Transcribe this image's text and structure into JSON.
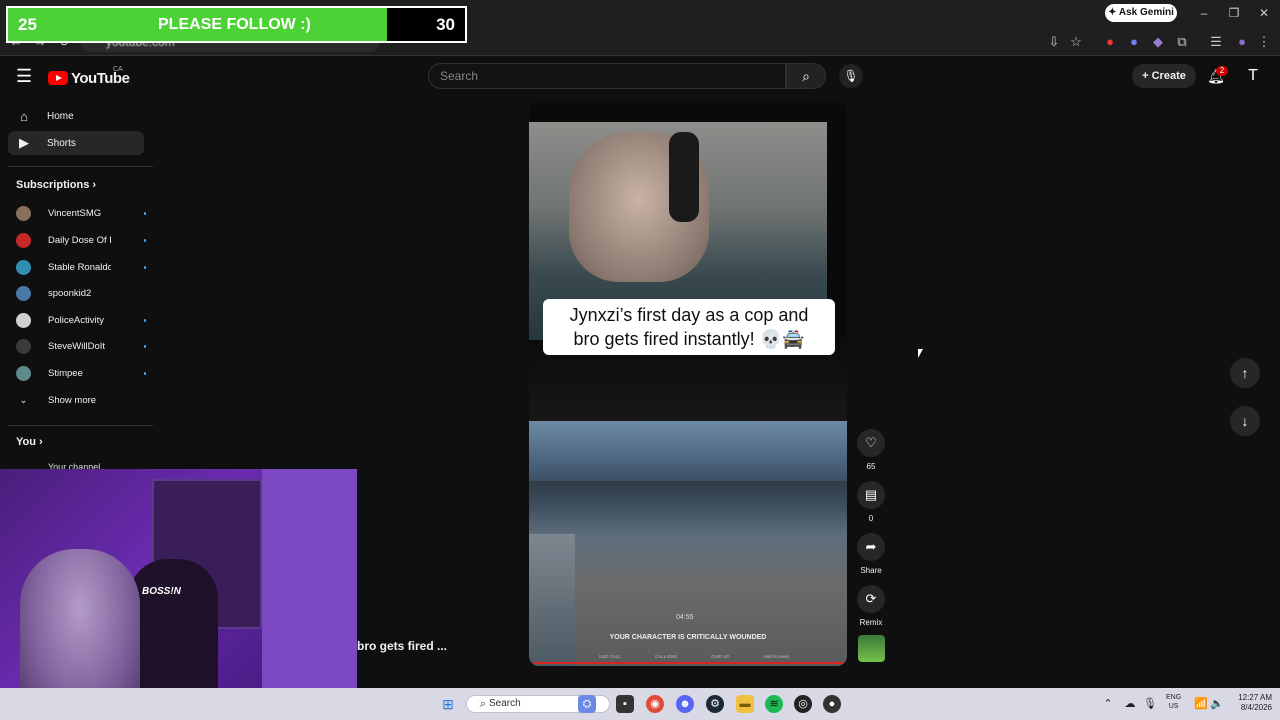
{
  "browser": {
    "url": "youtube.com",
    "gemini_label": "Ask Gemini",
    "icons": [
      "back-icon",
      "forward-icon",
      "reload-icon",
      "install-icon",
      "bookmark-star-icon",
      "extension-icon",
      "menu-dots-icon"
    ]
  },
  "overlay": {
    "current": "25",
    "text": "PLEASE FOLLOW :)",
    "goal": "30",
    "progress": 0.83,
    "color": "#4cd137"
  },
  "header": {
    "logo_text": "YouTube",
    "country": "CA",
    "search_placeholder": "Search",
    "create_label": "Create",
    "notification_count": "2",
    "brand_color": "#ff0000"
  },
  "sidebar": {
    "items": [
      {
        "label": "Home",
        "icon": "home-icon"
      },
      {
        "label": "Shorts",
        "icon": "shorts-icon"
      }
    ],
    "subscriptions_title": "Subscriptions",
    "subscriptions": [
      {
        "name": "VincentSMG",
        "color": "#8a6f5e"
      },
      {
        "name": "Daily Dose Of Int...",
        "color": "#c62828"
      },
      {
        "name": "Stable Ronaldo L...",
        "color": "#2f8fb0"
      },
      {
        "name": "spoonkid2",
        "color": "#4a78a8"
      },
      {
        "name": "PoliceActivity",
        "color": "#d0d0d0"
      },
      {
        "name": "SteveWillDoIt",
        "color": "#3a3a3a"
      },
      {
        "name": "Stimpee",
        "color": "#5e8a8a"
      }
    ],
    "show_more": "Show more",
    "you_title": "You",
    "your_channel": "Your channel"
  },
  "short": {
    "caption_line1": "Jynxzi’s first day as a cop and",
    "caption_line2": "bro gets fired instantly! 💀🚔",
    "hud_timer": "04:55",
    "hud_status": "YOUR CHARACTER IS CRITICALLY WOUNDED",
    "hud_options": [
      "USE CALL",
      "CALL EMS",
      "GIVE UP",
      "Hold to reset"
    ],
    "next_title": "bro gets fired ..."
  },
  "actions": {
    "likes": "65",
    "comments": "0",
    "share": "Share",
    "remix": "Remix"
  },
  "webcam": {
    "chair_text": "BOSS!N"
  },
  "taskbar": {
    "search_placeholder": "Search",
    "lang_line1": "ENG",
    "lang_line2": "US",
    "time": "12:27 AM",
    "date": "8/4/2026",
    "apps": [
      "windows-start-icon",
      "file-explorer-icon",
      "chrome-icon",
      "discord-icon",
      "steam-icon",
      "folder-icon",
      "spotify-icon",
      "obs-icon",
      "app-icon"
    ]
  }
}
